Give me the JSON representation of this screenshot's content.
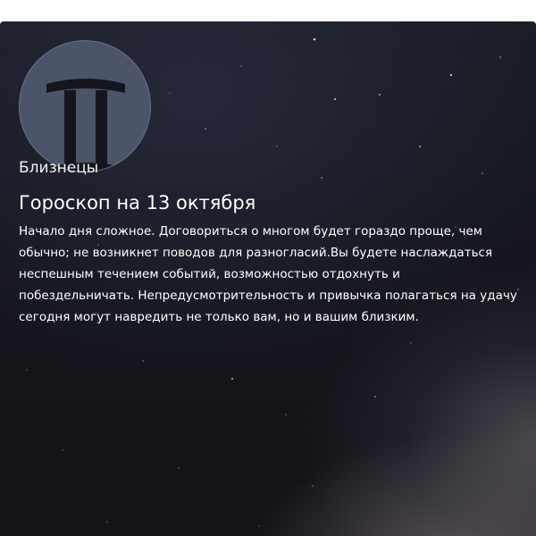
{
  "horoscope": {
    "sign_name": "Близнецы",
    "sign_icon": "gemini-icon",
    "title": "Гороскоп на 13 октября",
    "text": "Начало дня сложное. Договориться о многом будет гораздо проще, чем обычно; не возникнет поводов для разногласий.Вы будете наслаждаться неспешным течением событий, возможностью отдохнуть и побездельничать. Непредусмотрительность и привычка полагаться на удачу сегодня могут навредить не только вам, но и вашим близким."
  },
  "colors": {
    "background": "#15161d",
    "sign_circle": "#4b5468",
    "glyph": "#15161d",
    "text": "#ffffff"
  }
}
